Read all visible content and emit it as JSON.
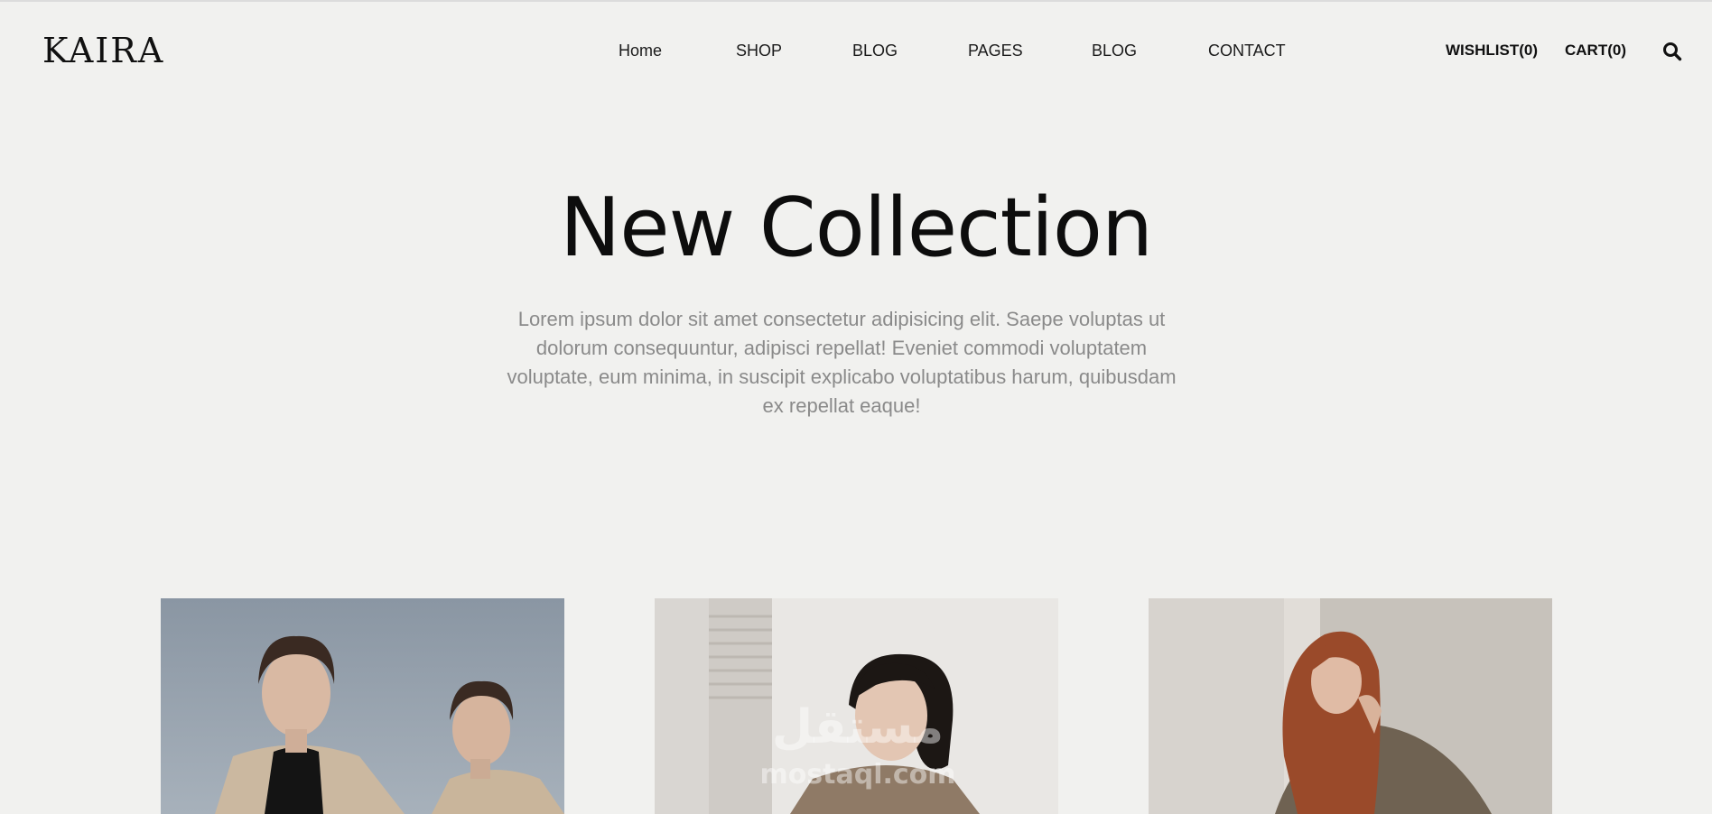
{
  "header": {
    "logo": "KAIRA",
    "nav": [
      {
        "label": "Home"
      },
      {
        "label": "SHOP"
      },
      {
        "label": "BLOG"
      },
      {
        "label": "PAGES"
      },
      {
        "label": "BLOG"
      },
      {
        "label": "CONTACT"
      }
    ],
    "wishlist_label": "WISHLIST(0)",
    "cart_label": "CART(0)",
    "search_icon": "search-icon"
  },
  "hero": {
    "title": "New Collection",
    "description": "Lorem ipsum dolor sit amet consectetur adipisicing elit. Saepe voluptas ut dolorum consequuntur, adipisci repellat! Eveniet commodi voluptatem voluptate, eum minima, in suscipit explicabo voluptatibus harum, quibusdam ex repellat eaque!"
  },
  "products": [
    {
      "image": "two-models-beige-coats-photo"
    },
    {
      "image": "model-leaning-wall-photo"
    },
    {
      "image": "red-haired-model-seated-photo"
    }
  ],
  "watermark": {
    "arabic": "مستقل",
    "latin": "mostaql.com"
  },
  "colors": {
    "background": "#f1f1ef",
    "text": "#111111",
    "muted_text": "#8a8a8a"
  }
}
